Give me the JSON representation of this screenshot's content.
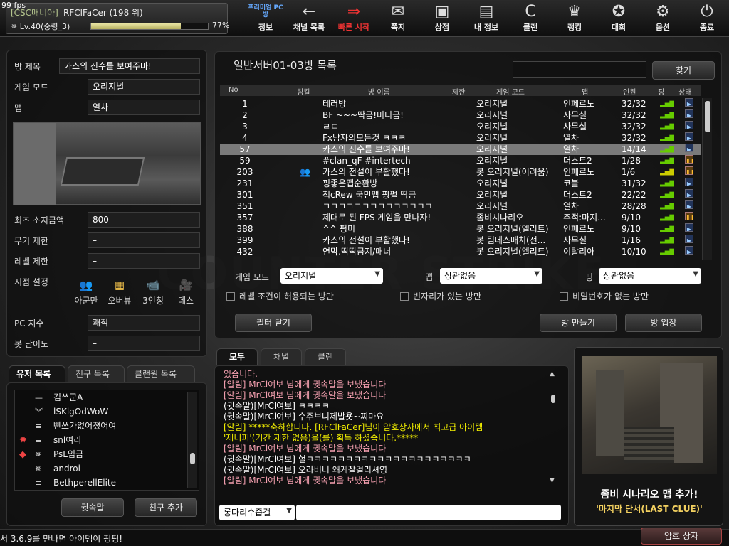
{
  "fps": "99 fps",
  "profile": {
    "clan": "[CSC매니아]",
    "nick": "RFClFaCer (198 위)",
    "level": "Lv.40(중령_3)",
    "exp_fraction": 0.77,
    "exp_pct": "77%"
  },
  "menu": [
    {
      "icon": "premium-pc-icon",
      "glyph": "PC",
      "label": "정보"
    },
    {
      "icon": "back-arrow-icon",
      "glyph": "←",
      "label": "채널 목록"
    },
    {
      "icon": "quick-start-icon",
      "glyph": "⇒",
      "label": "빠른 시작"
    },
    {
      "icon": "mail-icon",
      "glyph": "✉",
      "label": "쪽지"
    },
    {
      "icon": "shop-icon",
      "glyph": "▣",
      "label": "상점"
    },
    {
      "icon": "profile-card-icon",
      "glyph": "▤",
      "label": "내 정보"
    },
    {
      "icon": "clan-shield-icon",
      "glyph": "C",
      "label": "클랜"
    },
    {
      "icon": "trophy-icon",
      "glyph": "♛",
      "label": "랭킹"
    },
    {
      "icon": "medal-icon",
      "glyph": "✪",
      "label": "대회"
    },
    {
      "icon": "gear-icon",
      "glyph": "⚙",
      "label": "옵션"
    },
    {
      "icon": "power-icon",
      "glyph": "⏻",
      "label": "종료"
    }
  ],
  "menu_badge": "프리미엄 PC방",
  "room_info": {
    "title_label": "방 제목",
    "title_value": "카스의 진수를 보여주마!",
    "mode_label": "게임 모드",
    "mode_value": "오리지널",
    "map_label": "맵",
    "map_value": "열차",
    "money_label": "최초 소지금액",
    "money_value": "800",
    "weapon_label": "무기 제한",
    "weapon_value": "–",
    "level_label": "레벨 제한",
    "level_value": "–",
    "view_label": "시점 설정",
    "view_modes": [
      {
        "icon": "ally-only-icon",
        "glyph": "👥",
        "label": "아군만"
      },
      {
        "icon": "overview-icon",
        "glyph": "▦",
        "label": "오버뷰"
      },
      {
        "icon": "third-person-icon",
        "glyph": "📹",
        "label": "3인칭"
      },
      {
        "icon": "death-cam-icon",
        "glyph": "🎥",
        "label": "데스"
      }
    ],
    "pc_label": "PC 지수",
    "pc_value": "쾌적",
    "bot_label": "봇 난이도",
    "bot_value": "–"
  },
  "user_tabs": [
    "유저 목록",
    "친구 목록",
    "클랜원 목록"
  ],
  "users": [
    {
      "icon": "",
      "rank": "—",
      "name": "김쏘군A"
    },
    {
      "icon": "",
      "rank": "︾",
      "name": "lSKlgOdWoW"
    },
    {
      "icon": "",
      "rank": "≡",
      "name": "빤쓰가없어졌어여"
    },
    {
      "icon": "✹",
      "rank": "≡",
      "name": "snl여리"
    },
    {
      "icon": "◆",
      "rank": "✵",
      "name": "PsL임금"
    },
    {
      "icon": "",
      "rank": "✵",
      "name": "androi"
    },
    {
      "icon": "",
      "rank": "≡",
      "name": "BethperellElite"
    }
  ],
  "user_buttons": {
    "whisper": "귓속말",
    "add_friend": "친구 추가"
  },
  "room_list": {
    "title": "일반서버01-03방 목록",
    "search_button": "찾기",
    "columns": [
      "No",
      "팀킬",
      "방 이름",
      "제한",
      "게임 모드",
      "맵",
      "인원",
      "핑",
      "상태"
    ],
    "rows": [
      {
        "no": "1",
        "name": "테러방",
        "mode": "오리지널",
        "map": "인페르노",
        "players": "32/32",
        "status": "play"
      },
      {
        "no": "2",
        "name": "BF ~~~딱금!미니금!",
        "mode": "오리지널",
        "map": "사무실",
        "players": "32/32",
        "status": "play"
      },
      {
        "no": "3",
        "name": "ㄹㄷ",
        "mode": "오리지널",
        "map": "사무실",
        "players": "32/32",
        "status": "play"
      },
      {
        "no": "4",
        "name": "Fx남자의모든것 ㅋㅋㅋ",
        "mode": "오리지널",
        "map": "열차",
        "players": "32/32",
        "status": "play"
      },
      {
        "no": "57",
        "name": "카스의 진수를 보여주마!",
        "mode": "오리지널",
        "map": "열차",
        "players": "14/14",
        "status": "play",
        "selected": true
      },
      {
        "no": "59",
        "name": "#clan_qF #intertech",
        "mode": "오리지널",
        "map": "더스트2",
        "players": "1/28",
        "status": "wait"
      },
      {
        "no": "203",
        "name": "카스의 전설이 부활했다!",
        "mode": "봇 오리지널(어려움)",
        "map": "인페르노",
        "players": "1/6",
        "status": "wait",
        "teamkill": true
      },
      {
        "no": "231",
        "name": "핑좋은맵순환방",
        "mode": "오리지널",
        "map": "코블",
        "players": "31/32",
        "status": "play"
      },
      {
        "no": "301",
        "name": "척cRew 국민맵 핑펄 딱금",
        "mode": "오리지널",
        "map": "더스트2",
        "players": "22/22",
        "status": "play"
      },
      {
        "no": "351",
        "name": "ㄱㄱㄱㄱㄱㄱㄱㄱㄱㄱㄱㄱㄱㄱ",
        "mode": "오리지널",
        "map": "열차",
        "players": "28/28",
        "status": "play"
      },
      {
        "no": "357",
        "name": "제대로 된 FPS 게임을 만나자!",
        "mode": "좀비시나리오",
        "map": "추적:마지...",
        "players": "9/10",
        "status": "wait"
      },
      {
        "no": "388",
        "name": "^^ 펑미",
        "mode": "봇 오리지널(엘리트)",
        "map": "인페르노",
        "players": "9/10",
        "status": "play"
      },
      {
        "no": "399",
        "name": "카스의 전설이 부활했다!",
        "mode": "봇 팀데스매치(전...",
        "map": "사무실",
        "players": "1/16",
        "status": "play"
      },
      {
        "no": "432",
        "name": "연막.딱딱금지/매너",
        "mode": "봇 오리지널(엘리트)",
        "map": "이탈리아",
        "players": "10/10",
        "status": "play"
      }
    ]
  },
  "filter": {
    "mode_label": "게임 모드",
    "mode_value": "오리지널",
    "map_label": "맵",
    "map_value": "상관없음",
    "ping_label": "핑",
    "ping_value": "상관없음",
    "check_level": "레벨 조건이 허용되는 방만",
    "check_empty": "빈자리가 있는 방만",
    "check_nopass": "비밀번호가 없는 방만",
    "close_button": "필터 닫기",
    "create_button": "방 만들기",
    "join_button": "방 입장"
  },
  "chat": {
    "tabs": [
      "모두",
      "채널",
      "클랜"
    ],
    "lines": [
      {
        "kind": "alert",
        "text": "있습니다."
      },
      {
        "kind": "alert",
        "text": "[알림] MrCl여보 님에게 귓속말을 보냈습니다"
      },
      {
        "kind": "alert",
        "text": "[알림] MrCl여보 님에게 귓속말을 보냈습니다"
      },
      {
        "kind": "whisper",
        "text": "(귓속말)[MrCl여보] ㅋㅋㅋㅋ"
      },
      {
        "kind": "whisper",
        "text": "(귓속말)[MrCl여보] 수주브니제발욧~찌마요"
      },
      {
        "kind": "sys",
        "text": "[알림] *****축하합니다. [RFClFaCer]님이 암호상자에서 최고급 아이템"
      },
      {
        "kind": "sys",
        "text": "'제니퍼'(기간 제한 없음)을(를) 획득 하셨습니다.*****"
      },
      {
        "kind": "alert",
        "text": "[알림] MrCl여보 님에게 귓속말을 보냈습니다"
      },
      {
        "kind": "whisper",
        "text": "(귓속말)[MrCl여보] 헐ㅋㅋㅋㅋㅋㅋㅋㅋㅋㅋㅋㅋㅋㅋㅋㅋㅋㅋㅋㅋㅋ"
      },
      {
        "kind": "whisper",
        "text": "(귓속말)[MrCl여보] 오라버니 왜케잘걸리셔영"
      },
      {
        "kind": "alert",
        "text": "[알림] MrCl여보 님에게 귓속말을 보냈습니다"
      }
    ],
    "target": "롱다리수즙걸",
    "input_value": ""
  },
  "ad": {
    "title": "좀비 시나리오 맵 추가!",
    "subtitle": "'마지막 단서(LAST CLUE)'"
  },
  "footer": {
    "ticker": "서 3.6.9를 만나면 아이템이 펑펑!",
    "crate_button": "암호 상자"
  },
  "colors": {
    "alert": "#f5a0b0",
    "system": "#f4f000",
    "accent": "#e33333"
  }
}
